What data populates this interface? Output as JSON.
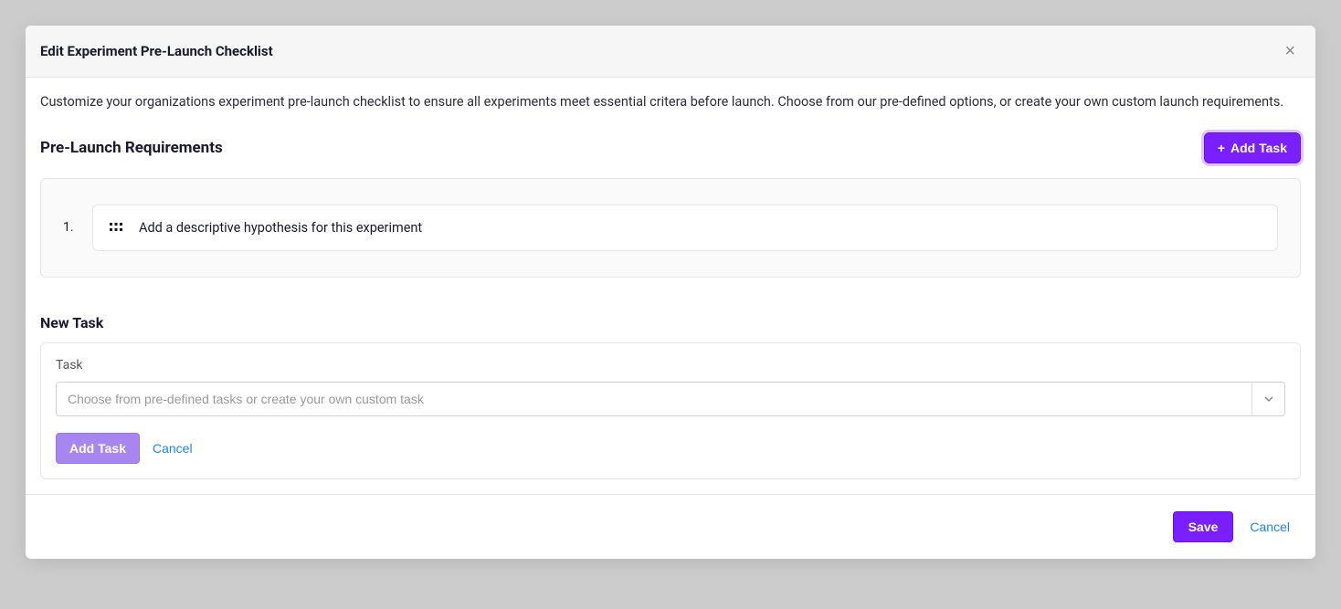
{
  "header": {
    "title": "Edit Experiment Pre-Launch Checklist"
  },
  "body": {
    "description": "Customize your organizations experiment pre-launch checklist to ensure all experiments meet essential critera before launch. Choose from our pre-defined options, or create your own custom launch requirements.",
    "requirements_heading": "Pre-Launch Requirements",
    "add_task_label": "Add Task",
    "requirements": [
      {
        "number": "1.",
        "text": "Add a descriptive hypothesis for this experiment"
      }
    ],
    "new_task": {
      "heading": "New Task",
      "field_label": "Task",
      "placeholder": "Choose from pre-defined tasks or create your own custom task",
      "add_label": "Add Task",
      "cancel_label": "Cancel"
    }
  },
  "footer": {
    "save_label": "Save",
    "cancel_label": "Cancel"
  }
}
